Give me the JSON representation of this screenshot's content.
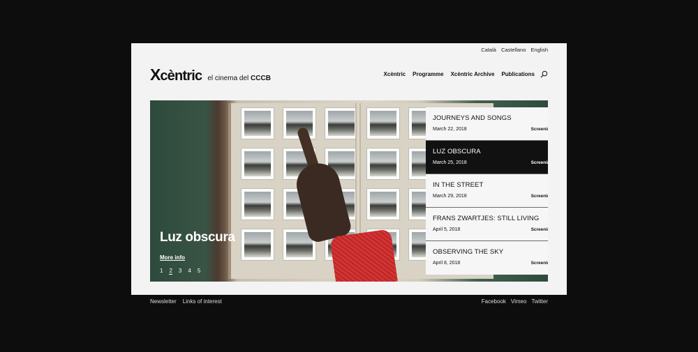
{
  "languages": [
    "Català",
    "Castellano",
    "English"
  ],
  "brand": {
    "logo_x": "X",
    "logo_rest": "cèntric",
    "tagline_prefix": "el cinema del",
    "tagline_bold": "CCCB"
  },
  "nav": [
    "Xcèntric",
    "Programme",
    "Xcèntric Archive",
    "Publications"
  ],
  "hero": {
    "title": "Luz obscura",
    "more_info": "More info",
    "pages": [
      "1",
      "2",
      "3",
      "4",
      "5"
    ],
    "active_page": 2
  },
  "events": [
    {
      "title": "JOURNEYS AND SONGS",
      "date": "March 22, 2018",
      "type": "Screening"
    },
    {
      "title": "LUZ OBSCURA",
      "date": "March 25, 2018",
      "type": "Screening"
    },
    {
      "title": "IN THE STREET",
      "date": "March 29, 2018",
      "type": "Screening"
    },
    {
      "title": "FRANS ZWARTJES: STILL LIVING",
      "date": "April 5, 2018",
      "type": "Screening"
    },
    {
      "title": "OBSERVING THE SKY",
      "date": "April 8, 2018",
      "type": "Screening"
    }
  ],
  "selected_event": 1,
  "footer": {
    "left": [
      "Newsletter",
      "Links of interest"
    ],
    "right": [
      "Facebook",
      "Vimeo",
      "Twitter"
    ]
  },
  "colors": {
    "page_bg": "#f3f3f3",
    "outer_bg": "#0d0d0d",
    "selected_bg": "#111111",
    "sleeve": "#d43433"
  }
}
